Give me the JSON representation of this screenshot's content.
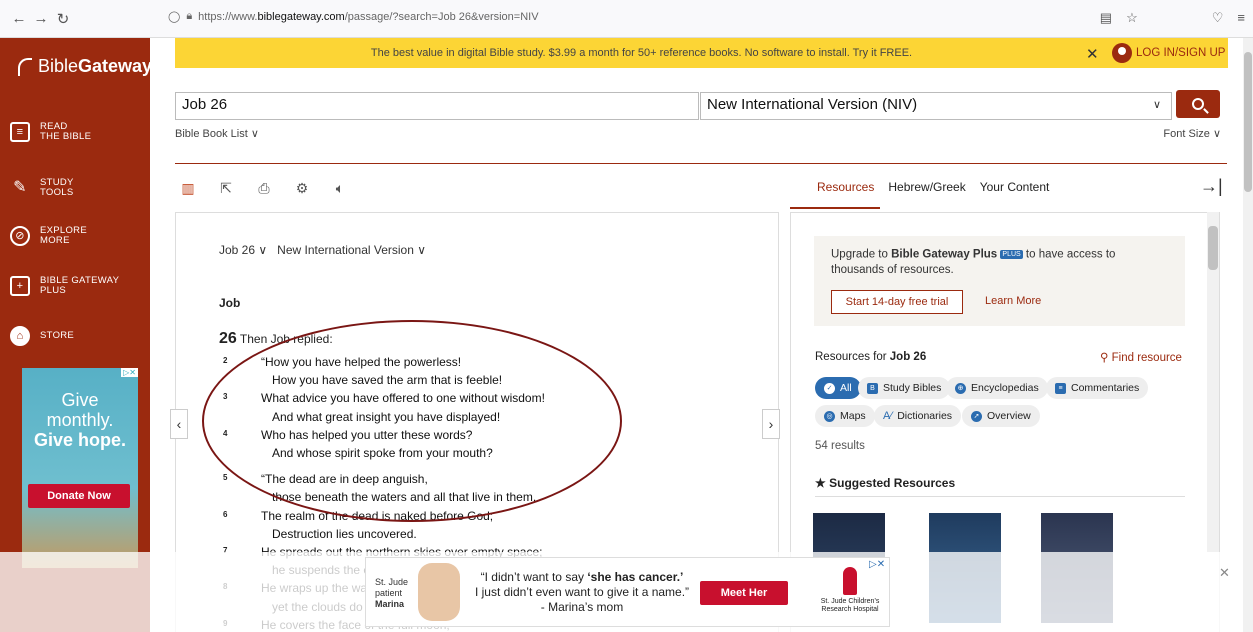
{
  "browser": {
    "url_prefix": "https://www.",
    "url_host": "biblegateway.com",
    "url_path": "/passage/?search=Job 26&version=NIV"
  },
  "sidebar": {
    "logo_left": "Bible",
    "logo_right": "Gateway",
    "items": [
      {
        "line1": "READ",
        "line2": "THE BIBLE"
      },
      {
        "line1": "STUDY",
        "line2": "TOOLS"
      },
      {
        "line1": "EXPLORE",
        "line2": "MORE"
      },
      {
        "line1": "BIBLE GATEWAY",
        "line2": "PLUS"
      },
      {
        "line1": "STORE",
        "line2": ""
      }
    ],
    "ad": {
      "line1": "Give",
      "line2": "monthly.",
      "line3": "Give hope.",
      "button": "Donate Now"
    }
  },
  "promo": {
    "text": "The best value in digital Bible study. $3.99 a month for 50+ reference books. No software to install. Try it FREE.",
    "login": "LOG IN/SIGN UP"
  },
  "search": {
    "query": "Job 26",
    "version": "New International Version (NIV)",
    "book_list": "Bible Book List",
    "font_size": "Font Size"
  },
  "resources_tabs": [
    "Resources",
    "Hebrew/Greek",
    "Your Content"
  ],
  "passage": {
    "ref": "Job 26",
    "version": "New International Version",
    "book_title": "Job",
    "chapter_num": "26",
    "chapter_intro": "Then Job replied:",
    "lines": [
      {
        "num": "2",
        "text": "“How you have helped the powerless!",
        "indent": false
      },
      {
        "num": "",
        "text": "How you have saved the arm that is feeble!",
        "indent": true
      },
      {
        "num": "3",
        "text": "What advice you have offered to one without wisdom!",
        "indent": false
      },
      {
        "num": "",
        "text": "And what great insight you have displayed!",
        "indent": true
      },
      {
        "num": "4",
        "text": "Who has helped you utter these words?",
        "indent": false
      },
      {
        "num": "",
        "text": "And whose spirit spoke from your mouth?",
        "indent": true
      },
      {
        "num": "5",
        "text": "“The dead are in deep anguish,",
        "indent": false
      },
      {
        "num": "",
        "text": "those beneath the waters and all that live in them.",
        "indent": true
      },
      {
        "num": "6",
        "text": "The realm of the dead is naked before God;",
        "indent": false
      },
      {
        "num": "",
        "text": "Destruction lies uncovered.",
        "indent": true
      },
      {
        "num": "7",
        "text": "He spreads out the northern skies over empty space;",
        "indent": false
      },
      {
        "num": "",
        "text": "he suspends the earth over nothing.",
        "indent": true
      },
      {
        "num": "8",
        "text": "He wraps up the waters in his clouds,",
        "indent": false
      },
      {
        "num": "",
        "text": "yet the clouds do not burst under their weight.",
        "indent": true
      },
      {
        "num": "9",
        "text": "He covers the face of the full moon,",
        "indent": false
      }
    ]
  },
  "resources": {
    "upgrade_pre": "Upgrade to ",
    "upgrade_bold": "Bible Gateway Plus",
    "upgrade_badge": "PLUS",
    "upgrade_post": " to have access to thousands of resources.",
    "trial_button": "Start 14-day free trial",
    "learn_more": "Learn More",
    "resources_for": "Resources for ",
    "resources_for_ref": "Job 26",
    "find_resource": "Find resource",
    "filters": [
      "All",
      "Study Bibles",
      "Encyclopedias",
      "Commentaries",
      "Maps",
      "Dictionaries",
      "Overview"
    ],
    "results": "54 results",
    "suggested": "Suggested Resources"
  },
  "bottom_ad": {
    "patient_line1": "St. Jude",
    "patient_line2": "patient",
    "patient_name": "Marina",
    "quote_pre": "“I didn’t want to say ",
    "quote_bold": "‘she has cancer.’",
    "quote_line2": "I just didn’t even want to give it a name.”",
    "quote_attr": "- Marina’s mom",
    "button": "Meet Her",
    "logo_line1": "St. Jude Children’s",
    "logo_line2": "Research Hospital"
  },
  "colors": {
    "brand": "#9b2a0f",
    "promo": "#fcd535",
    "accent_blue": "#2b6cb0"
  }
}
